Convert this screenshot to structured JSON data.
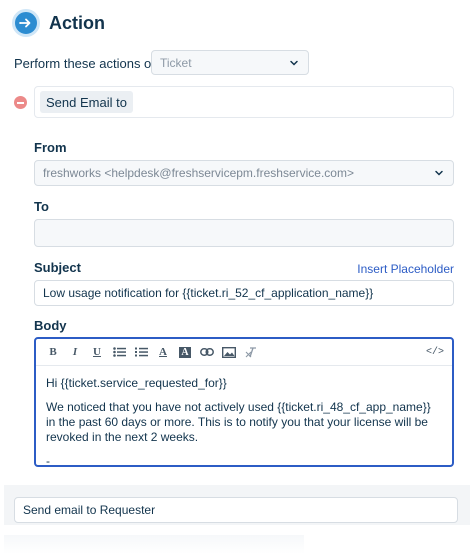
{
  "header": {
    "title": "Action",
    "icon": "arrow-right-circle-icon",
    "accent": "#2c8cd1"
  },
  "perform": {
    "label": "Perform these actions on",
    "selected": "Ticket"
  },
  "action": {
    "selected": "Send Email to",
    "remove_icon": "minus-circle-icon"
  },
  "from": {
    "label": "From",
    "value": "freshworks <helpdesk@freshservicepm.freshservice.com>"
  },
  "to": {
    "label": "To",
    "value": ""
  },
  "subject": {
    "label": "Subject",
    "insert_placeholder": "Insert Placeholder",
    "value": "Low usage notification for {{ticket.ri_52_cf_application_name}}"
  },
  "body": {
    "label": "Body",
    "toolbar": [
      "bold-icon",
      "italic-icon",
      "underline-icon",
      "bullet-list-icon",
      "numbered-list-icon",
      "text-color-icon",
      "background-color-icon",
      "link-icon",
      "image-icon",
      "clear-format-icon",
      "code-view-icon"
    ],
    "toolbar_glyphs": {
      "bold": "B",
      "italic": "I",
      "underline": "U",
      "text_color": "A",
      "background_color": "A",
      "code": "</>"
    },
    "lines": [
      "Hi {{ticket.service_requested_for}}",
      "We noticed that you have not actively used {{ticket.ri_48_cf_app_name}} in the past 60 days or more. This is to notify you that your license will be revoked in the next 2 weeks.",
      "-"
    ]
  },
  "footer": {
    "value": "Send email to Requester"
  },
  "colors": {
    "focus_border": "#2c5cc5",
    "link": "#2c5cc5",
    "remove": "#ec8a89",
    "panel_bg": "#f3f5f7"
  }
}
